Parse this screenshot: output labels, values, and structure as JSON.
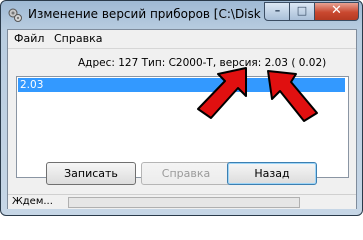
{
  "window": {
    "title": "Изменение версий приборов [C:\\Disk D\\pr...",
    "minimize_glyph": "–",
    "maximize_glyph": "□",
    "close_glyph": "✕"
  },
  "menu": {
    "items": [
      {
        "label": "Файл"
      },
      {
        "label": "Справка"
      }
    ]
  },
  "info_line": "Адрес: 127 Тип: С2000-Т, версия: 2.03 ( 0.02)",
  "list": {
    "items": [
      {
        "label": "2.03",
        "selected": true
      }
    ]
  },
  "buttons": {
    "write_label": "Записать",
    "help_label": "Справка",
    "back_label": "Назад"
  },
  "status": {
    "text": "Ждем..."
  },
  "colors": {
    "selection": "#3399ff",
    "annotation_arrow": "#e01010"
  }
}
